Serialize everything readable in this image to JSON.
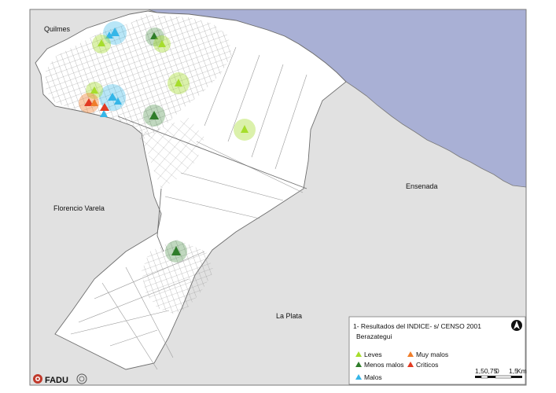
{
  "places": {
    "quilmes": "Quilmes",
    "florencio_varela": "Florencio Varela",
    "ensenada": "Ensenada",
    "la_plata": "La Plata"
  },
  "legend": {
    "title": "1- Resultados del INDICE- s/ CENSO 2001",
    "subtitle": "Berazategui",
    "items": [
      {
        "label": "Leves",
        "color": "#a6dd2c"
      },
      {
        "label": "Menos malos",
        "color": "#2f7d2a"
      },
      {
        "label": "Malos",
        "color": "#35b6e8"
      },
      {
        "label": "Muy malos",
        "color": "#f07d2a"
      },
      {
        "label": "Criticos",
        "color": "#e23a22"
      }
    ],
    "north_icon": "north-arrow-icon"
  },
  "scale_bar": {
    "left_label": "1,50,75",
    "zero_label": "0",
    "right_label": "1,5",
    "unit": "Km"
  },
  "logo": {
    "text": "FADU",
    "icon": "fadu-emblem-icon"
  },
  "colors": {
    "water": "#a9b0d5",
    "land": "#e1e1e1",
    "municipality": "#ffffff",
    "street": "#8c8c8c",
    "border": "#7a7a7a"
  },
  "markers": [
    {
      "category": "Malos",
      "name": "marker-malos-quilmes-north"
    },
    {
      "category": "Leves",
      "name": "marker-leves-quilmes-north"
    },
    {
      "category": "Menos malos",
      "name": "marker-menos-malos-north"
    },
    {
      "category": "Leves",
      "name": "marker-leves-north"
    },
    {
      "category": "Leves",
      "name": "marker-leves-center"
    },
    {
      "category": "Malos",
      "name": "marker-malos-west"
    },
    {
      "category": "Leves",
      "name": "marker-leves-west"
    },
    {
      "category": "Criticos",
      "name": "marker-criticos-west"
    },
    {
      "category": "Muy malos",
      "name": "marker-muy-malos-west"
    },
    {
      "category": "Menos malos",
      "name": "marker-menos-malos-center"
    },
    {
      "category": "Leves",
      "name": "marker-leves-east"
    },
    {
      "category": "Menos malos",
      "name": "marker-menos-malos-south"
    }
  ]
}
